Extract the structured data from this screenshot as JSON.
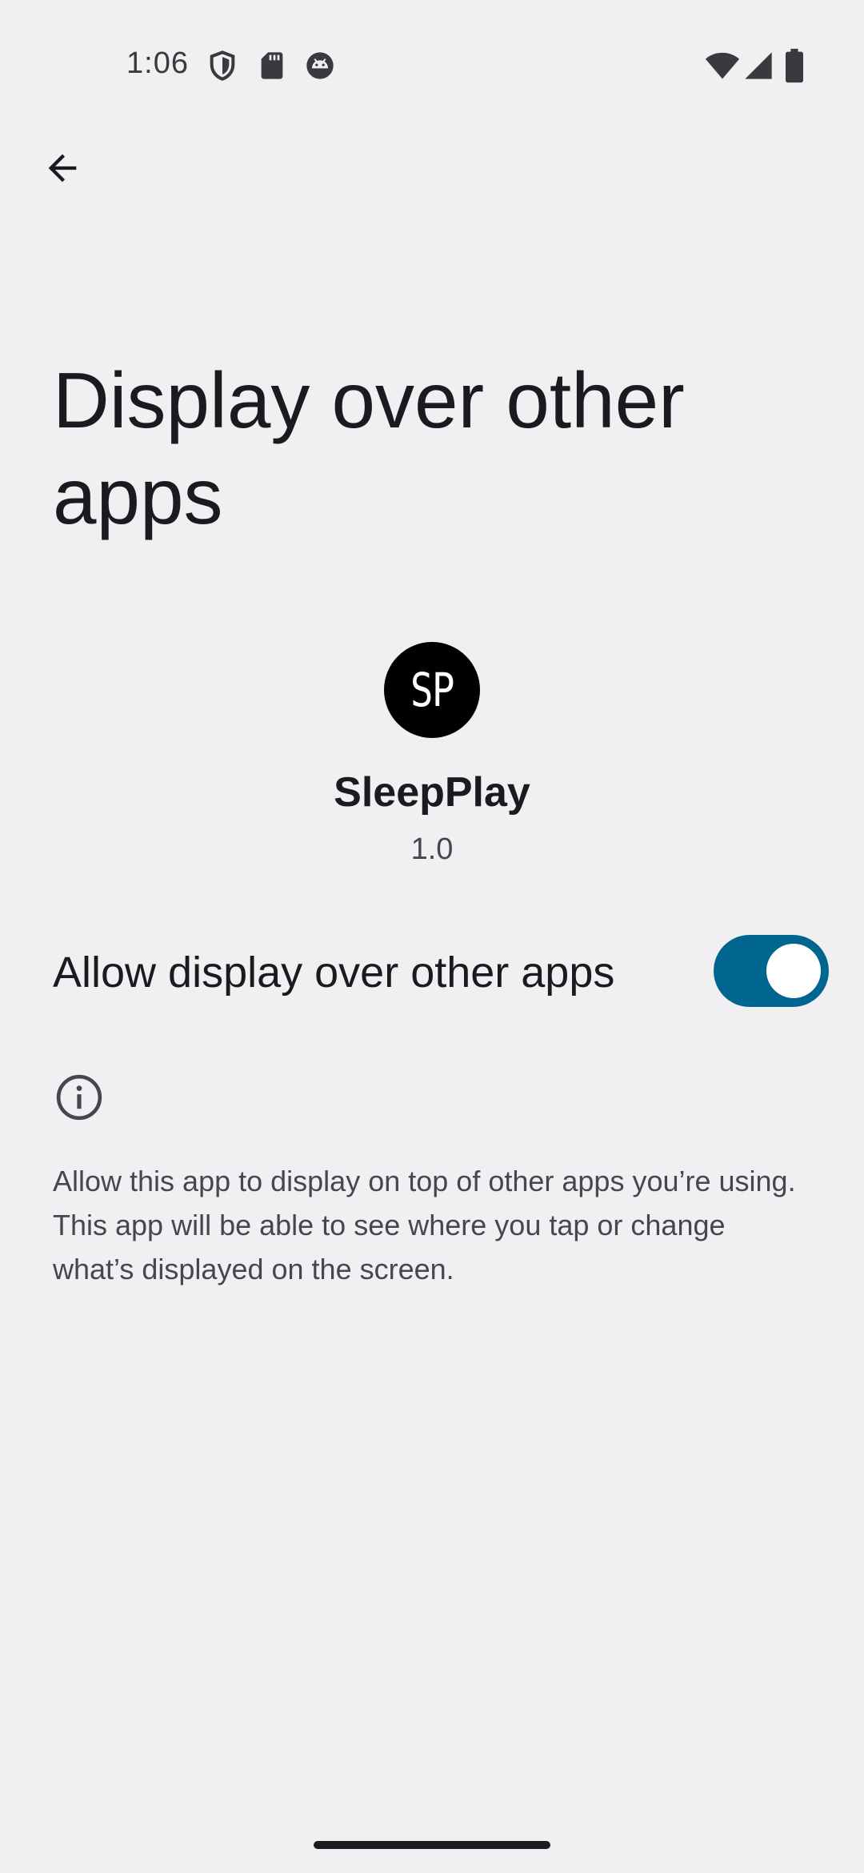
{
  "status_bar": {
    "time": "1:06",
    "icons_left": [
      "shield-icon",
      "sd-card-icon",
      "android-debug-icon"
    ],
    "icons_right": [
      "wifi-icon",
      "signal-icon",
      "battery-icon"
    ]
  },
  "header": {
    "back_icon": "arrow-back-icon",
    "title": "Display over other apps"
  },
  "app": {
    "icon_text": "SP",
    "name": "SleepPlay",
    "version": "1.0"
  },
  "setting": {
    "label": "Allow display over other apps",
    "enabled": true
  },
  "info": {
    "icon": "info-icon",
    "text": "Allow this app to display on top of other apps you’re using. This app will be able to see where you tap or change what’s displayed on the screen."
  },
  "colors": {
    "background": "#f0f0f3",
    "toggle_on": "#00658f",
    "text_primary": "#1b1b1f",
    "text_secondary": "#46464f"
  }
}
